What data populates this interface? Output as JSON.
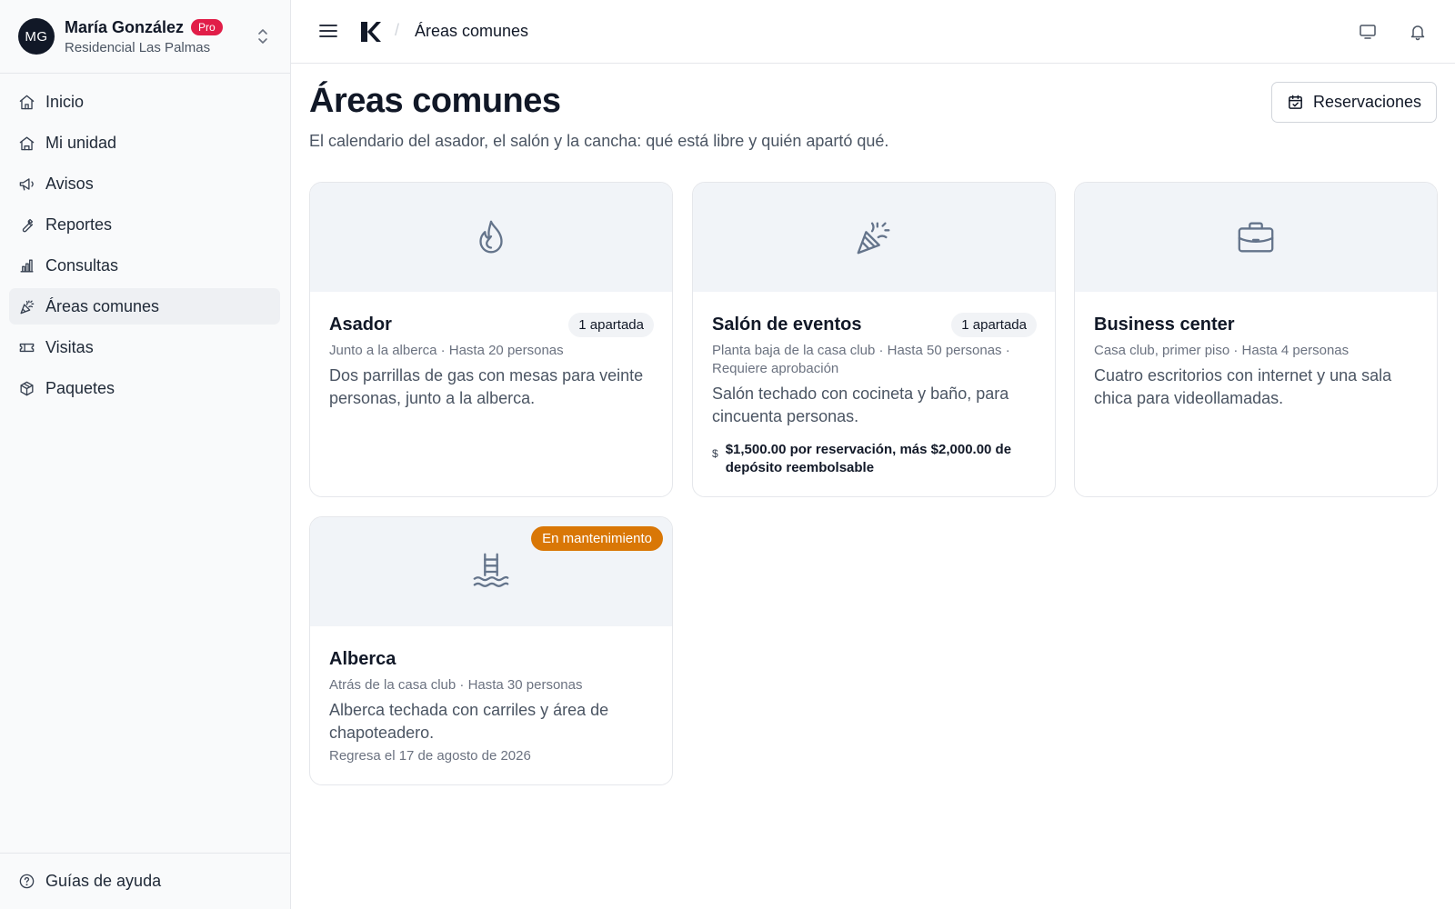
{
  "user": {
    "initials": "MG",
    "name": "María González",
    "badge": "Pro",
    "community": "Residencial Las Palmas"
  },
  "nav": {
    "items": [
      {
        "label": "Inicio",
        "icon": "home-icon"
      },
      {
        "label": "Mi unidad",
        "icon": "house-icon"
      },
      {
        "label": "Avisos",
        "icon": "megaphone-icon"
      },
      {
        "label": "Reportes",
        "icon": "wrench-icon"
      },
      {
        "label": "Consultas",
        "icon": "bar-chart-icon"
      },
      {
        "label": "Áreas comunes",
        "icon": "party-popper-icon"
      },
      {
        "label": "Visitas",
        "icon": "ticket-icon"
      },
      {
        "label": "Paquetes",
        "icon": "package-icon"
      }
    ],
    "active": "Áreas comunes",
    "help_label": "Guías de ayuda"
  },
  "topbar": {
    "breadcrumb_sep": "/",
    "breadcrumb": "Áreas comunes"
  },
  "page": {
    "title": "Áreas comunes",
    "subtitle": "El calendario del asador, el salón y la cancha: qué está libre y quién apartó qué.",
    "reservations_button": "Reservaciones"
  },
  "areas": [
    {
      "name": "Asador",
      "icon": "flame-icon",
      "badge": "1 apartada",
      "meta": "Junto a la alberca · Hasta 20 personas",
      "description": "Dos parrillas de gas con mesas para veinte personas, junto a la alberca."
    },
    {
      "name": "Salón de eventos",
      "icon": "party-popper-icon",
      "badge": "1 apartada",
      "meta": "Planta baja de la casa club · Hasta 50 personas · Requiere aprobación",
      "description": "Salón techado con cocineta y baño, para cincuenta personas.",
      "price_sign": "$",
      "price": "$1,500.00 por reservación, más $2,000.00 de depósito reembolsable"
    },
    {
      "name": "Business center",
      "icon": "briefcase-icon",
      "meta": "Casa club, primer piso · Hasta 4 personas",
      "description": "Cuatro escritorios con internet y una sala chica para videollamadas."
    },
    {
      "name": "Alberca",
      "icon": "pool-ladder-icon",
      "status": "En mantenimiento",
      "meta": "Atrás de la casa club · Hasta 30 personas",
      "description": "Alberca techada con carriles y área de chapoteadero.",
      "note": "Regresa el 17 de agosto de 2026"
    }
  ],
  "colors": {
    "accent_pro": "#e11d48",
    "maintenance": "#d97706",
    "card_header_bg": "#f1f4f8",
    "icon_stroke": "#64748b"
  }
}
